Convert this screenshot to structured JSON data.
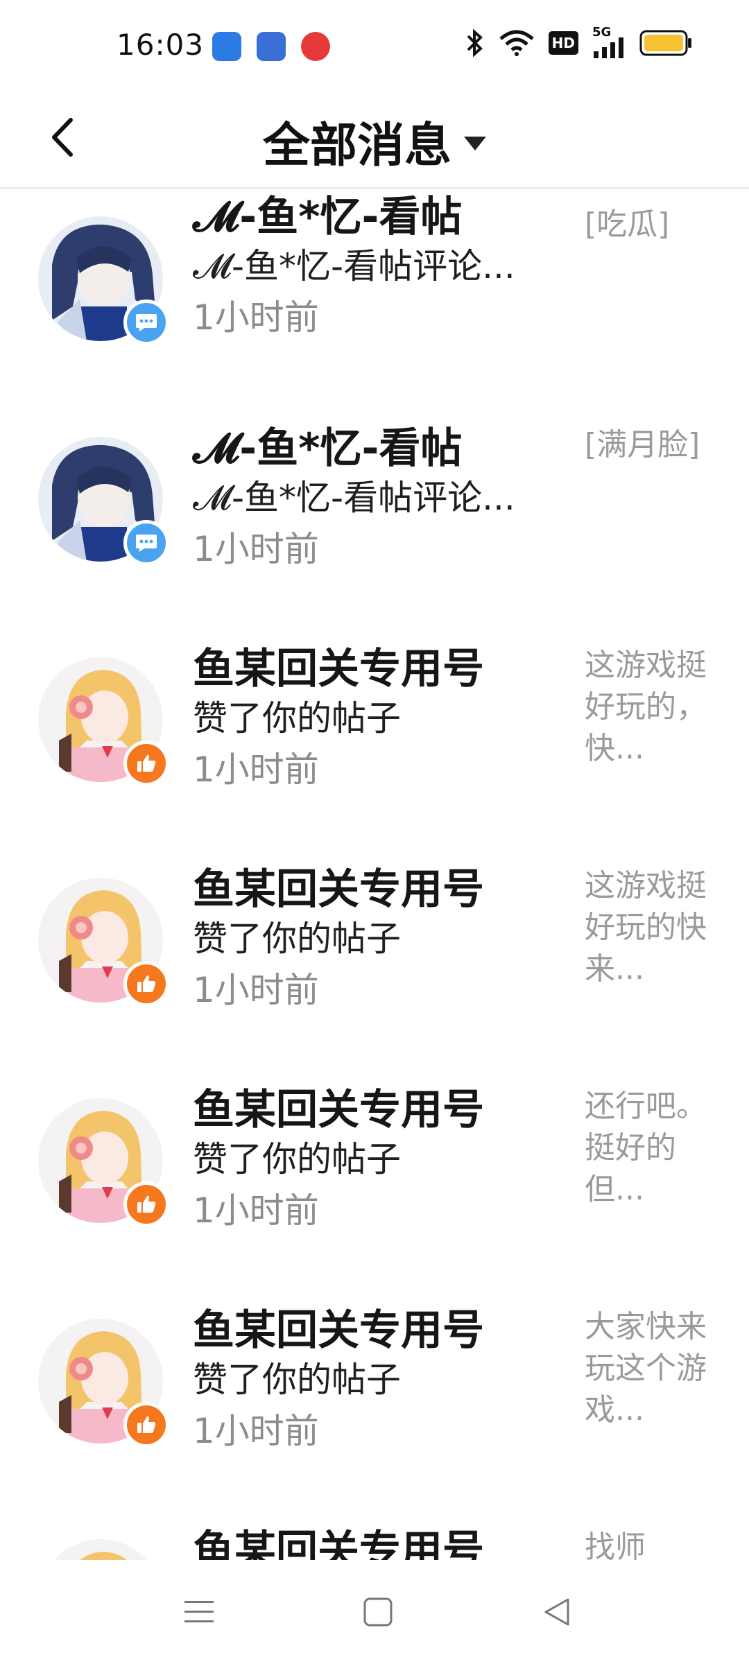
{
  "status_bar": {
    "time": "16:03",
    "notification_icons": [
      "baidu-disk-icon",
      "baidu-app-icon",
      "video-app-icon"
    ],
    "system_icons": [
      "bluetooth-icon",
      "wifi-icon",
      "hd-icon",
      "signal-5g-icon",
      "battery-icon"
    ],
    "hd_label": "HD",
    "network_label": "5G"
  },
  "header": {
    "title": "全部消息",
    "back_icon": "back-arrow-icon",
    "dropdown_icon": "caret-down-icon"
  },
  "messages": [
    {
      "name": "𝓜-鱼*忆-看帖",
      "action": "𝓜-鱼*忆-看帖评论...",
      "time": "1小时前",
      "preview": "[吃瓜]",
      "badge": "comment-icon",
      "avatar": "blue-hair-avatar"
    },
    {
      "name": "𝓜-鱼*忆-看帖",
      "action": "𝓜-鱼*忆-看帖评论...",
      "time": "1小时前",
      "preview": "[满月脸]",
      "badge": "comment-icon",
      "avatar": "blue-hair-avatar"
    },
    {
      "name": "鱼某回关专用号",
      "action": "赞了你的帖子",
      "time": "1小时前",
      "preview": "这游戏挺好玩的，快...",
      "badge": "like-icon",
      "avatar": "blonde-headphones-avatar"
    },
    {
      "name": "鱼某回关专用号",
      "action": "赞了你的帖子",
      "time": "1小时前",
      "preview": "这游戏挺好玩的快来...",
      "badge": "like-icon",
      "avatar": "blonde-headphones-avatar"
    },
    {
      "name": "鱼某回关专用号",
      "action": "赞了你的帖子",
      "time": "1小时前",
      "preview": "还行吧。挺好的但...",
      "badge": "like-icon",
      "avatar": "blonde-headphones-avatar"
    },
    {
      "name": "鱼某回关专用号",
      "action": "赞了你的帖子",
      "time": "1小时前",
      "preview": "大家快来玩这个游戏...",
      "badge": "like-icon",
      "avatar": "blonde-headphones-avatar"
    },
    {
      "name": "鱼某回关专用号",
      "action": "",
      "time": "",
      "preview": "找师",
      "badge": "like-icon",
      "avatar": "blonde-headphones-avatar"
    }
  ],
  "navbar": {
    "items": [
      "menu-icon",
      "home-square-icon",
      "back-triangle-icon"
    ]
  },
  "colors": {
    "comment_badge": "#4aa3f0",
    "like_badge": "#f5781f",
    "battery_fill": "#f5c233",
    "secondary_text": "#8c8c8c"
  }
}
